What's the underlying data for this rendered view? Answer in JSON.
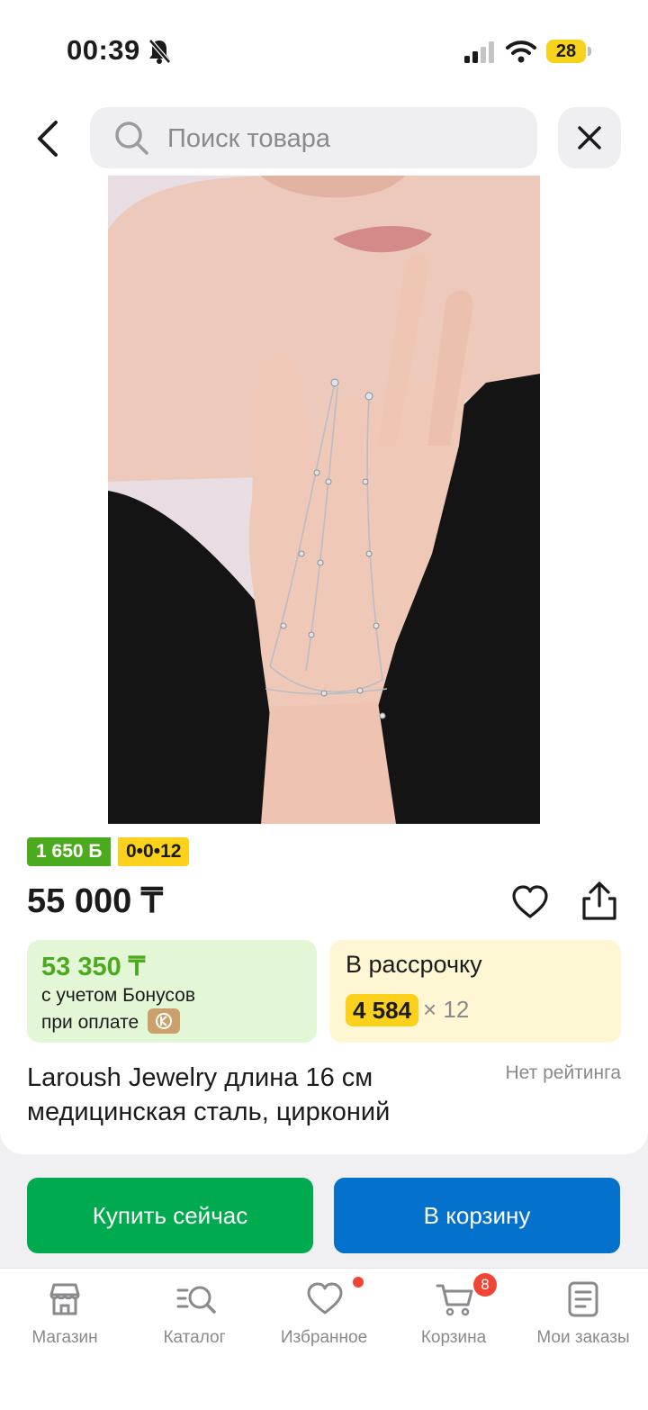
{
  "status_bar": {
    "time": "00:39",
    "battery": "28",
    "icons": [
      "bell-slash-icon",
      "signal-icon",
      "wifi-icon",
      "battery-icon"
    ]
  },
  "header": {
    "search_placeholder": "Поиск товара",
    "icons": [
      "back-chevron-icon",
      "search-icon",
      "close-icon"
    ]
  },
  "product": {
    "bonus_badge": "1 650 Б",
    "installment_badge": "0•0•12",
    "price": "55 000 ₸",
    "bonus_price": "53 350 ₸",
    "bonus_line1": "с учетом Бонусов",
    "bonus_line2": "при оплате",
    "installment_title": "В рассрочку",
    "installment_amount": "4 584",
    "installment_times": "× 12",
    "title": "Laroush Jewelry длина 16 см медицинская сталь, цирконий",
    "rating": "Нет рейтинга",
    "icons": [
      "heart-icon",
      "share-icon",
      "kaspi-wallet-icon"
    ]
  },
  "actions": {
    "buy_now": "Купить сейчас",
    "add_to_cart": "В корзину"
  },
  "colors": {
    "green": "#00aa4e",
    "blue": "#0471cd",
    "bonus_green": "#4caa1e",
    "yellow": "#fbd11b",
    "red": "#f14635"
  },
  "tabbar": {
    "cart_count": "8",
    "items": [
      {
        "label": "Магазин",
        "icon": "store-icon"
      },
      {
        "label": "Каталог",
        "icon": "catalog-search-icon"
      },
      {
        "label": "Избранное",
        "icon": "heart-outline-icon"
      },
      {
        "label": "Корзина",
        "icon": "cart-icon"
      },
      {
        "label": "Мои заказы",
        "icon": "orders-icon"
      }
    ]
  }
}
